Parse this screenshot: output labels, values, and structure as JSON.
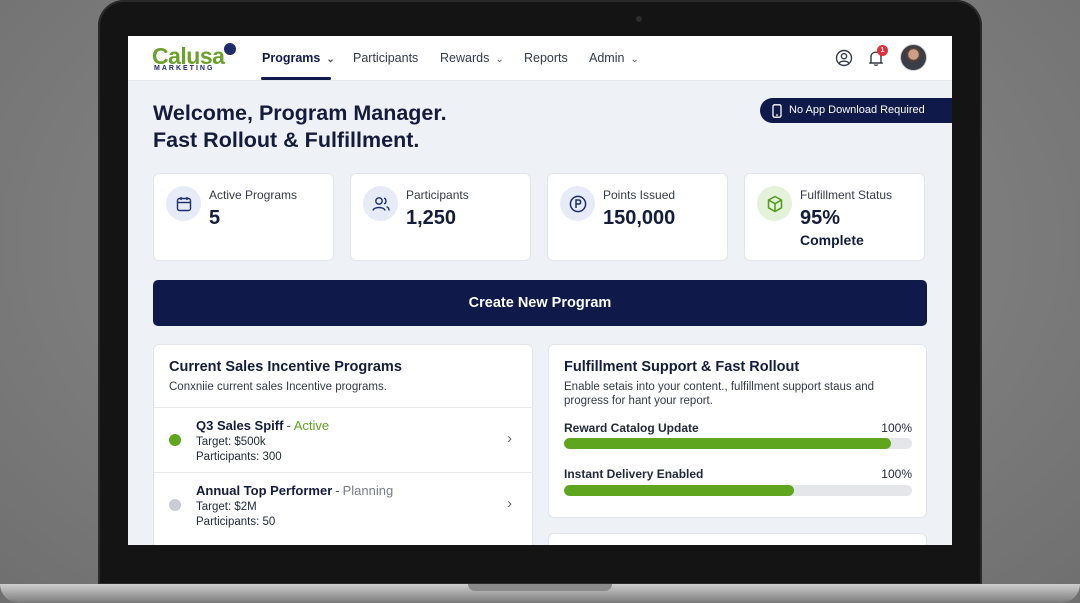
{
  "brand": {
    "name": "Calusa",
    "tagline": "MARKETING"
  },
  "nav": {
    "items": [
      {
        "label": "Programs",
        "has_dropdown": true,
        "active": true
      },
      {
        "label": "Participants",
        "has_dropdown": false
      },
      {
        "label": "Rewards",
        "has_dropdown": true
      },
      {
        "label": "Reports",
        "has_dropdown": false
      },
      {
        "label": "Admin",
        "has_dropdown": true
      }
    ],
    "notification_count": "1",
    "icons": [
      "user-circle-icon",
      "bell-icon"
    ]
  },
  "banner": {
    "label": "No App Download Required",
    "icon": "phone-icon"
  },
  "welcome": {
    "line1": "Welcome, Program Manager.",
    "line2": "Fast Rollout & Fulfillment."
  },
  "stats": [
    {
      "label": "Active Programs",
      "value": "5",
      "icon": "calendar-icon"
    },
    {
      "label": "Participants",
      "value": "1,250",
      "icon": "users-icon"
    },
    {
      "label": "Points Issued",
      "value": "150,000",
      "icon": "points-icon"
    },
    {
      "label": "Fulfillment Status",
      "value": "95%",
      "sub": "Complete",
      "icon": "box-icon"
    }
  ],
  "create_button": "Create New Program",
  "programs_panel": {
    "title": "Current Sales Incentive Programs",
    "description": "Conxniie current sales Incentive programs.",
    "items": [
      {
        "name": "Q3 Sales Spiff",
        "separator": "-",
        "status": "Active",
        "target": "Target: $500k",
        "participants": "Participants: 300",
        "status_color": "#5fa51e"
      },
      {
        "name": "Annual Top Performer",
        "separator": "-",
        "status": "Planning",
        "target": "Target: $2M",
        "participants": "Participants: 50",
        "status_color": "#c9ccd4"
      }
    ]
  },
  "fulfillment_panel": {
    "title": "Fulfillment Support & Fast Rollout",
    "description": "Enable setais into your content., fulfillment support staus and progress for hant your report.",
    "progress": [
      {
        "label": "Reward Catalog Update",
        "percent_text": "100%",
        "fill_fraction": 0.94
      },
      {
        "label": "Instant Delivery Enabled",
        "percent_text": "100%",
        "fill_fraction": 0.66
      }
    ]
  },
  "colors": {
    "navy": "#0f1a4a",
    "green": "#5fa51e",
    "background": "#eef1f5"
  }
}
